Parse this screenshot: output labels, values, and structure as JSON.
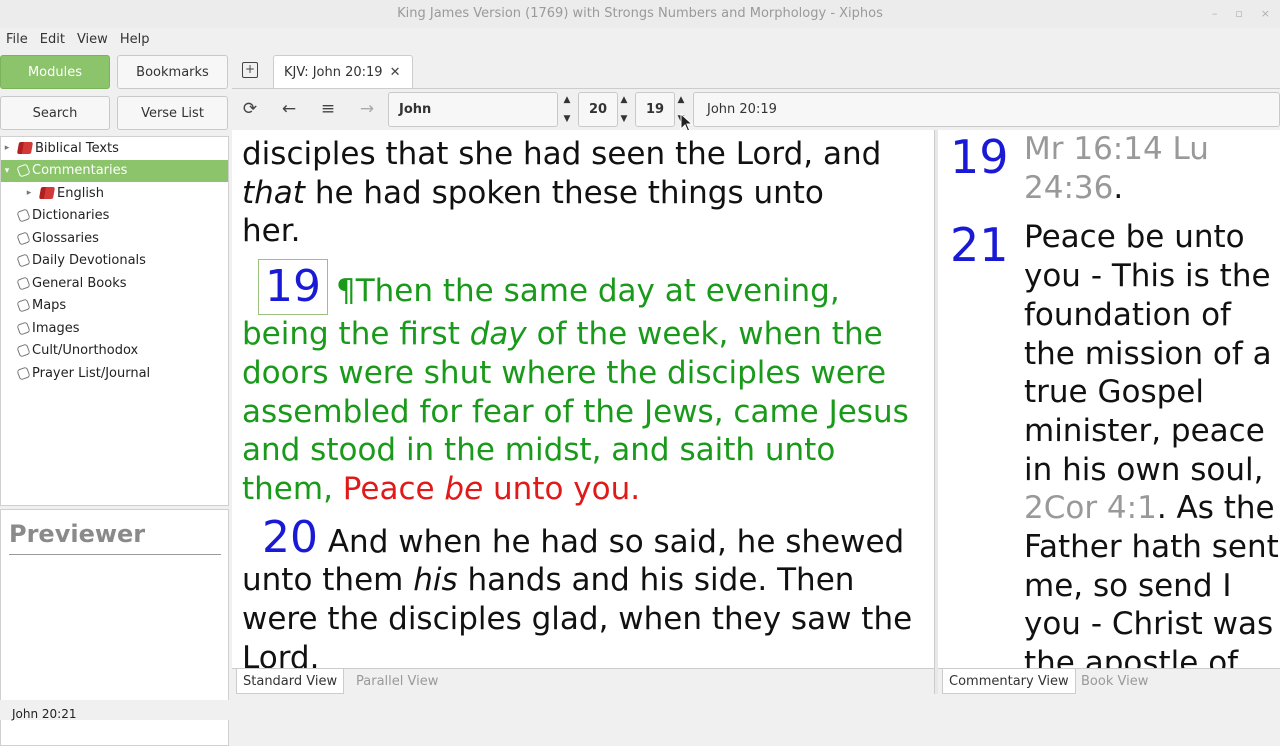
{
  "window": {
    "title": "King James Version (1769) with Strongs Numbers and Morphology - Xiphos"
  },
  "menu": [
    "File",
    "Edit",
    "View",
    "Help"
  ],
  "sidebar": {
    "buttons": {
      "modules": "Modules",
      "bookmarks": "Bookmarks",
      "search": "Search",
      "verse_list": "Verse List"
    },
    "tree": [
      {
        "label": "Biblical Texts",
        "icon": "book-icon",
        "expander": "▸"
      },
      {
        "label": "Commentaries",
        "icon": "folder-icon",
        "expander": "▾",
        "selected": true
      },
      {
        "label": "English",
        "icon": "book-icon",
        "expander": "▸",
        "indent": 1
      },
      {
        "label": "Dictionaries",
        "icon": "folder-icon"
      },
      {
        "label": "Glossaries",
        "icon": "folder-icon"
      },
      {
        "label": "Daily Devotionals",
        "icon": "folder-icon"
      },
      {
        "label": "General Books",
        "icon": "folder-icon"
      },
      {
        "label": "Maps",
        "icon": "folder-icon"
      },
      {
        "label": "Images",
        "icon": "folder-icon"
      },
      {
        "label": "Cult/Unorthodox",
        "icon": "folder-icon"
      },
      {
        "label": "Prayer List/Journal",
        "icon": "folder-icon"
      }
    ],
    "previewer_title": "Previewer"
  },
  "tabs": [
    {
      "label": "KJV: John 20:19",
      "close": "✕"
    }
  ],
  "nav": {
    "book": "John",
    "chapter": "20",
    "verse": "19",
    "reference": "John 20:19"
  },
  "bible": {
    "v18_tail_line1": "disciples that she had seen the Lord, and",
    "v18_tail_italic": "that",
    "v18_tail_line2": " he had spoken these things unto",
    "v18_tail_line3": "her.",
    "v19_num": "19",
    "v19_a": "¶Then the same day at evening, being the first ",
    "v19_italic": "day",
    "v19_b": " of the week, when the doors were shut where the disciples were assembled for fear of the Jews, came Jesus and stood in the midst, and saith unto them, ",
    "v19_red_a": "Peace ",
    "v19_red_italic": "be",
    "v19_red_b": " unto you.",
    "v20_num": "20",
    "v20_a": " And when he had so said, he shewed unto them ",
    "v20_italic": "his",
    "v20_b": " hands and his side. Then were the disciples glad, when they saw the Lord."
  },
  "bottom_tabs_left": [
    "Standard View",
    "Parallel View"
  ],
  "commentary": {
    "c19_num": "19",
    "c19_lines": [
      "Mr 16:14 Lu",
      "24:36"
    ],
    "c19_dot": ".",
    "c21_num": "21",
    "c21_lines": [
      "Peace be unto",
      "you - This is the",
      "foundation of",
      "the mission of a",
      "true Gospel",
      "minister, peace",
      "in his own soul,"
    ],
    "c21_ref": "2Cor 4:1",
    "c21_after_ref": ". As the",
    "c21_more": [
      "Father hath sent",
      "me, so send I",
      "you - Christ was",
      "the apostle of"
    ]
  },
  "bottom_tabs_right": [
    "Commentary View",
    "Book View"
  ],
  "status": "John 20:21"
}
